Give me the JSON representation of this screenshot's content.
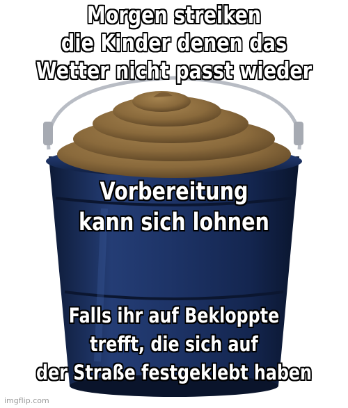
{
  "meme": {
    "top_lines": [
      "Morgen streiken",
      "die Kinder denen das",
      "Wetter nicht passt wieder"
    ],
    "middle_lines": [
      "Vorbereitung",
      "kann sich lohnen"
    ],
    "bottom_lines": [
      "Falls ihr auf Bekloppte",
      "trefft, die sich auf",
      "der Straße festgeklebt haben"
    ],
    "watermark": "imgflip.com"
  },
  "colors": {
    "bucket": "#1f3566",
    "bucket_dark": "#0f1d3d",
    "poop": "#8a6a3c",
    "handle": "#b8bcc4"
  }
}
